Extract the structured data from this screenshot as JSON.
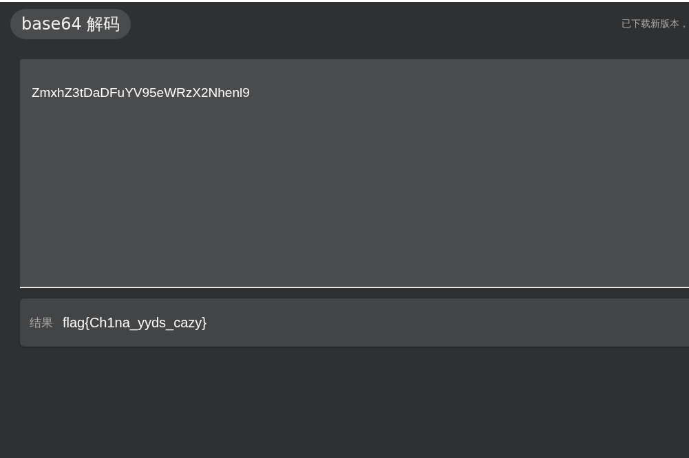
{
  "title": "base64 解码",
  "notice": "已下载新版本，",
  "input": {
    "value": "ZmxhZ3tDaDFuYV95eWRzX2Nhenl9"
  },
  "result": {
    "label": "结果",
    "value": "flag{Ch1na_yyds_cazy}"
  }
}
